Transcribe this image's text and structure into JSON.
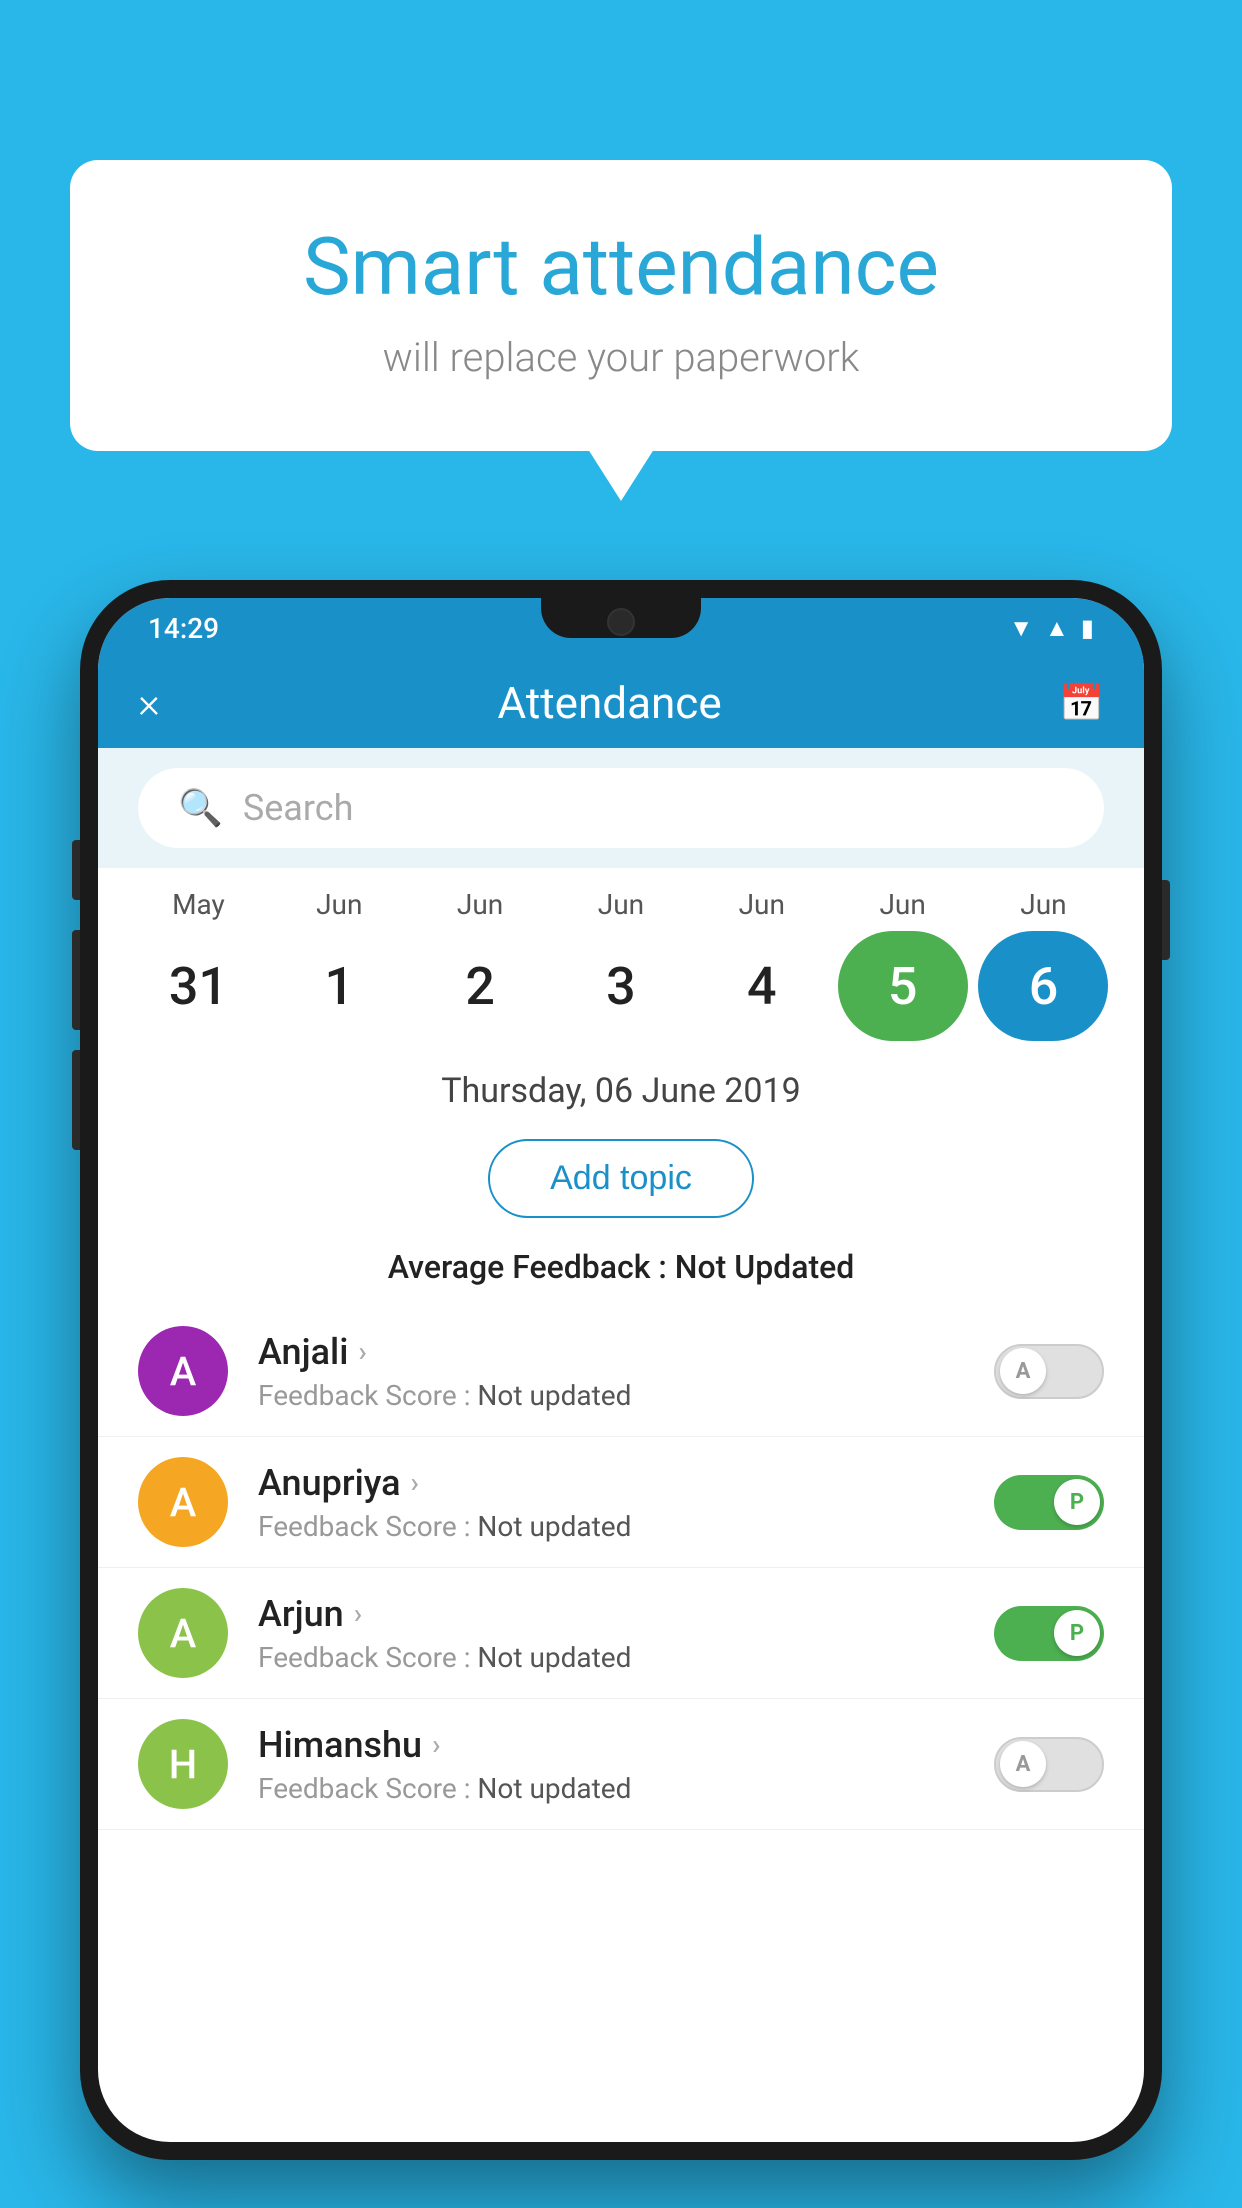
{
  "background_color": "#29b6e8",
  "speech_bubble": {
    "title": "Smart attendance",
    "subtitle": "will replace your paperwork"
  },
  "phone": {
    "status_bar": {
      "time": "14:29",
      "icons": [
        "wifi",
        "signal",
        "battery"
      ]
    },
    "header": {
      "close_label": "×",
      "title": "Attendance",
      "calendar_icon": "calendar"
    },
    "search": {
      "placeholder": "Search"
    },
    "calendar": {
      "months": [
        "May",
        "Jun",
        "Jun",
        "Jun",
        "Jun",
        "Jun",
        "Jun"
      ],
      "dates": [
        "31",
        "1",
        "2",
        "3",
        "4",
        "5",
        "6"
      ],
      "today_index": 5,
      "selected_index": 6
    },
    "selected_date": "Thursday, 06 June 2019",
    "add_topic_label": "Add topic",
    "avg_feedback_label": "Average Feedback : ",
    "avg_feedback_value": "Not Updated",
    "students": [
      {
        "name": "Anjali",
        "avatar_letter": "A",
        "avatar_color": "#9c27b0",
        "feedback_label": "Feedback Score : ",
        "feedback_value": "Not updated",
        "toggle": "off",
        "toggle_letter": "A"
      },
      {
        "name": "Anupriya",
        "avatar_letter": "A",
        "avatar_color": "#f5a623",
        "feedback_label": "Feedback Score : ",
        "feedback_value": "Not updated",
        "toggle": "on",
        "toggle_letter": "P"
      },
      {
        "name": "Arjun",
        "avatar_letter": "A",
        "avatar_color": "#8bc34a",
        "feedback_label": "Feedback Score : ",
        "feedback_value": "Not updated",
        "toggle": "on",
        "toggle_letter": "P"
      },
      {
        "name": "Himanshu",
        "avatar_letter": "H",
        "avatar_color": "#8bc34a",
        "feedback_label": "Feedback Score : ",
        "feedback_value": "Not updated",
        "toggle": "off",
        "toggle_letter": "A"
      }
    ]
  }
}
